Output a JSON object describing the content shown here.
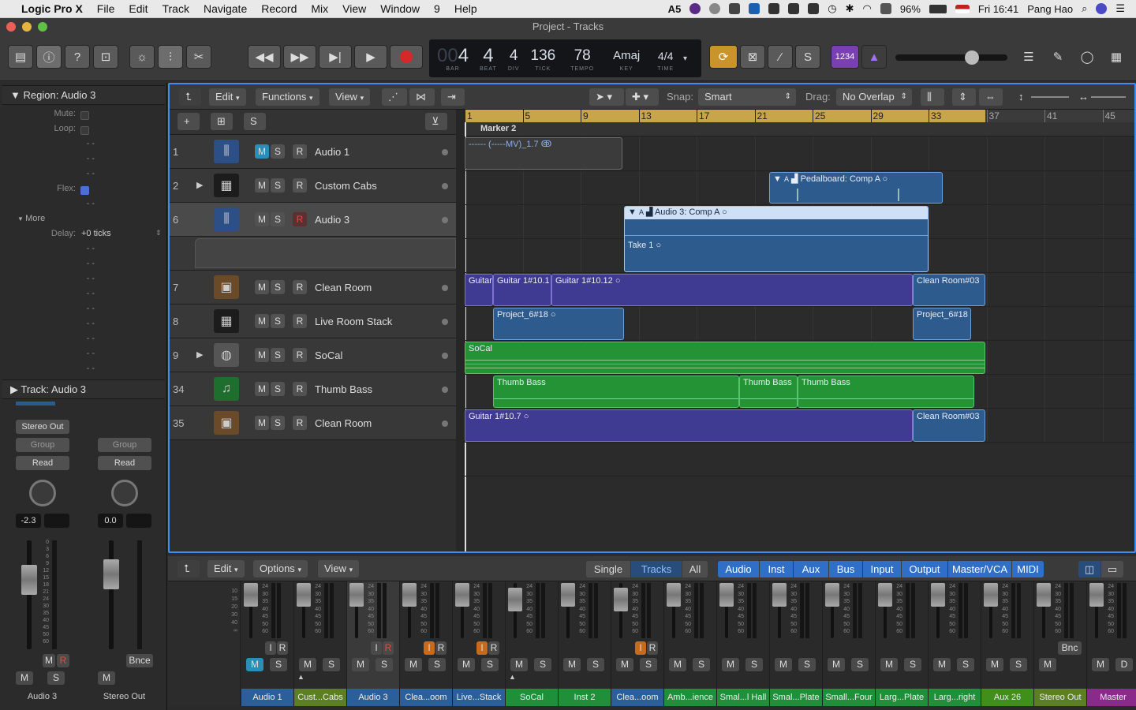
{
  "menubar": {
    "items": [
      "Logic Pro X",
      "File",
      "Edit",
      "Track",
      "Navigate",
      "Record",
      "Mix",
      "View",
      "Window",
      "9",
      "Help"
    ],
    "adobe_count": "5",
    "battery": "96%",
    "clock": "Fri 16:41",
    "user": "Pang Hao"
  },
  "window": {
    "title": "Project - Tracks"
  },
  "lcd": {
    "bar": "4",
    "bar_label": "BAR",
    "beat": "4",
    "beat_label": "BEAT",
    "div": "4",
    "div_label": "DIV",
    "tick": "136",
    "tick_label": "TICK",
    "tempo": "78",
    "tempo_label": "TEMPO",
    "key": "Amaj",
    "key_label": "KEY",
    "time": "4/4",
    "time_label": "TIME"
  },
  "ctrl": {
    "count_in": "1234"
  },
  "inspector": {
    "region_header": "Region:",
    "region_name": "Audio 3",
    "mute": "Mute:",
    "loop": "Loop:",
    "flex": "Flex:",
    "more": "More",
    "delay_label": "Delay:",
    "delay_value": "+0 ticks",
    "dash": "- -",
    "track_header": "Track:",
    "track_name": "Audio 3",
    "strips": [
      {
        "output": "Stereo Out",
        "group": "Group",
        "auto": "Read",
        "value": "-2.3",
        "name": "Audio 3"
      },
      {
        "group": "Group",
        "auto": "Read",
        "value": "0.0",
        "bnce": "Bnce",
        "name": "Stereo Out"
      }
    ],
    "scale": [
      "0",
      "3",
      "6",
      "9",
      "12",
      "15",
      "18",
      "21",
      "24",
      "30",
      "35",
      "40",
      "45",
      "50",
      "60"
    ]
  },
  "tracks_toolbar": {
    "edit": "Edit",
    "functions": "Functions",
    "view": "View",
    "snap_label": "Snap:",
    "snap_value": "Smart",
    "drag_label": "Drag:",
    "drag_value": "No Overlap"
  },
  "tracks": [
    {
      "num": "1",
      "name": "Audio 1",
      "icon": "waveform-icon"
    },
    {
      "num": "2",
      "name": "Custom Cabs",
      "icon": "amp-cabinet-icon"
    },
    {
      "num": "6",
      "name": "Audio 3",
      "icon": "waveform-icon"
    },
    {
      "num": "7",
      "name": "Clean Room",
      "icon": "combo-amp-icon"
    },
    {
      "num": "8",
      "name": "Live Room Stack",
      "icon": "amp-stack-icon"
    },
    {
      "num": "9",
      "name": "SoCal",
      "icon": "drum-kit-icon"
    },
    {
      "num": "34",
      "name": "Thumb Bass",
      "icon": "music-note-icon"
    },
    {
      "num": "35",
      "name": "Clean Room",
      "icon": "combo-amp-icon"
    }
  ],
  "ruler": [
    "1",
    "5",
    "9",
    "13",
    "17",
    "21",
    "25",
    "29",
    "33",
    "37",
    "41",
    "45"
  ],
  "marker": "Marker 2",
  "regions": {
    "audio1": "------ (-----MV)_1.7",
    "pedalboard": "Pedalboard: Comp A",
    "audio3": "Audio 3: Comp A",
    "take1": "Take 1",
    "guitar_a": "Guitar",
    "guitar_b": "Guitar 1#10.1",
    "guitar_c": "Guitar 1#10.12",
    "clean_room_a": "Clean Room#03",
    "project_a": "Project_6#18",
    "project_b": "Project_6#18",
    "socal": "SoCal",
    "thumb_a": "Thumb Bass",
    "thumb_b": "Thumb Bass",
    "thumb_c": "Thumb Bass",
    "guitar_d": "Guitar 1#10.7",
    "clean_room_b": "Clean Room#03",
    "flag_a": "A"
  },
  "mixer_toolbar": {
    "edit": "Edit",
    "options": "Options",
    "view": "View",
    "modes": [
      "Single",
      "Tracks",
      "All"
    ],
    "filters": [
      "Audio",
      "Inst",
      "Aux",
      "Bus",
      "Input",
      "Output",
      "Master/VCA",
      "MIDI"
    ]
  },
  "mixer_scale": [
    "24",
    "30",
    "35",
    "40",
    "45",
    "50",
    "60"
  ],
  "mixer_scale_first": [
    "10",
    "15",
    "20",
    "30",
    "40",
    "∞"
  ],
  "mixer_strips": [
    {
      "name": "Audio 1",
      "color": "#2a5f9a"
    },
    {
      "name": "Cust...Cabs",
      "color": "#5c7f24"
    },
    {
      "name": "Audio 3",
      "color": "#2a5f9a"
    },
    {
      "name": "Clea...oom",
      "color": "#2a5f9a"
    },
    {
      "name": "Live...Stack",
      "color": "#2a5f9a"
    },
    {
      "name": "SoCal",
      "color": "#1f8f3a"
    },
    {
      "name": "Inst 2",
      "color": "#1f8f3a"
    },
    {
      "name": "Clea...oom",
      "color": "#2a5f9a"
    },
    {
      "name": "Amb...ience",
      "color": "#1f8f3a"
    },
    {
      "name": "Smal...l Hall",
      "color": "#1f8f3a"
    },
    {
      "name": "Smal...Plate",
      "color": "#1f8f3a"
    },
    {
      "name": "Small...Four",
      "color": "#1f8f3a"
    },
    {
      "name": "Larg...Plate",
      "color": "#1f8f3a"
    },
    {
      "name": "Larg...right",
      "color": "#1f8f3a"
    },
    {
      "name": "Aux 26",
      "color": "#3f8f1a"
    },
    {
      "name": "Stereo Out",
      "color": "#5c7f24"
    },
    {
      "name": "Master",
      "color": "#8a2a8a"
    }
  ],
  "mixer_labels": {
    "m": "M",
    "s": "S",
    "i": "I",
    "r": "R",
    "d": "D",
    "bnc": "Bnc"
  },
  "buttons": {
    "m": "M",
    "s": "S",
    "r": "R"
  }
}
